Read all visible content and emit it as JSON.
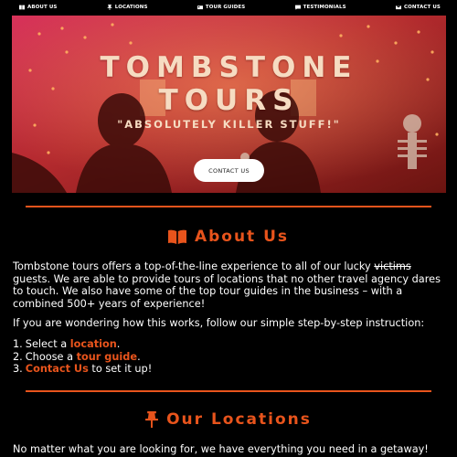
{
  "nav": {
    "items": [
      {
        "label": "ABOUT US",
        "icon": "book-icon"
      },
      {
        "label": "LOCATIONS",
        "icon": "pin-icon"
      },
      {
        "label": "TOUR GUIDES",
        "icon": "id-card-icon"
      },
      {
        "label": "TESTIMONIALS",
        "icon": "comment-icon"
      },
      {
        "label": "CONTACT US",
        "icon": "envelope-icon"
      }
    ]
  },
  "hero": {
    "title_line1": "TOMBSTONE",
    "title_line2": "TOURS",
    "tagline": "\"ABSOLUTELY KILLER STUFF!\"",
    "cta_label": "CONTACT US"
  },
  "about": {
    "heading": "About Us",
    "p1_part1": "Tombstone tours offers a top-of-the-line experience to all of our lucky ",
    "p1_strike": "victims",
    "p1_part2": " guests. We are able to provide tours of locations that no other travel agency dares to touch. We also have some of the top tour guides in the business – with a combined 500+ years of experience!",
    "p2": "If you are wondering how this works, follow our simple step-by-step instruction:",
    "steps": [
      {
        "num": "1.",
        "pre": "Select a ",
        "link": "location",
        "post": "."
      },
      {
        "num": "2.",
        "pre": "Choose a ",
        "link": "tour guide",
        "post": "."
      },
      {
        "num": "3.",
        "pre": "",
        "link": "Contact Us",
        "post": " to set it up!"
      }
    ]
  },
  "locations": {
    "heading": "Our Locations",
    "p1": "No matter what you are looking for, we have everything you need in a getaway! Secluded"
  },
  "colors": {
    "accent": "#e8541c",
    "background": "#000000",
    "hero_text": "#f6dcc2"
  }
}
